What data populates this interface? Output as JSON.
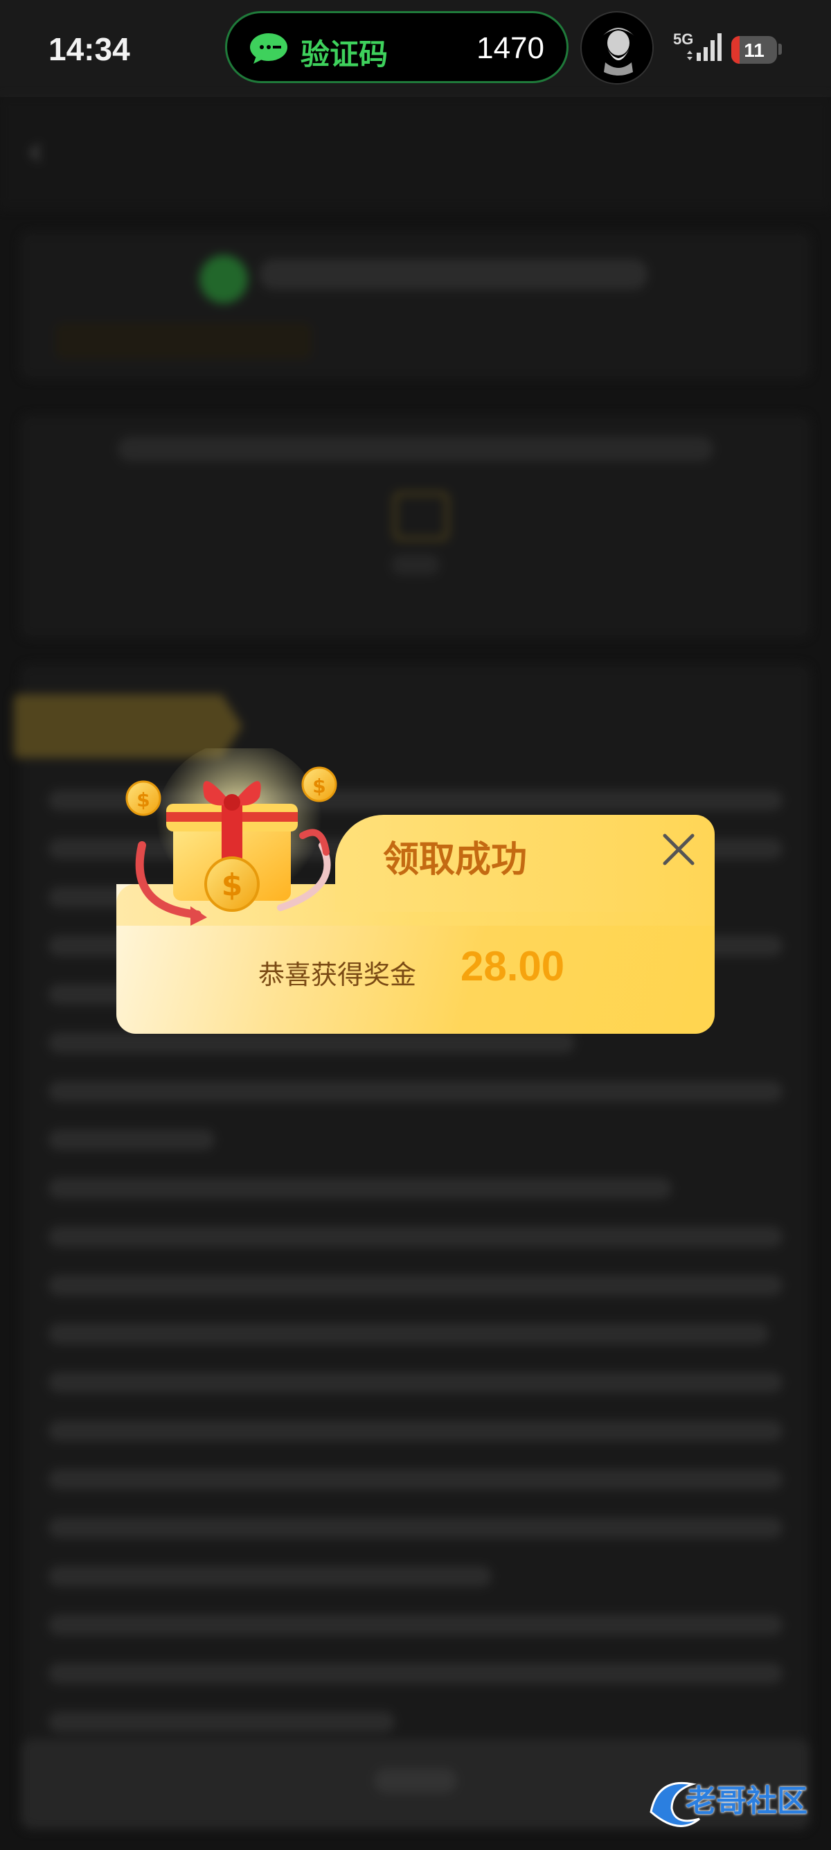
{
  "status_bar": {
    "time": "14:34",
    "island_label": "验证码",
    "island_code": "1470",
    "network": "5G",
    "battery": "11"
  },
  "dialog": {
    "title": "领取成功",
    "prize_label": "恭喜获得奖金",
    "prize_amount": "28.00"
  },
  "watermark": {
    "text": "老哥社区"
  },
  "colors": {
    "accent_orange": "#c46a12",
    "amount_yellow": "#f6a30e",
    "wechat_green": "#3ed15c",
    "battery_red": "#e0362c"
  }
}
